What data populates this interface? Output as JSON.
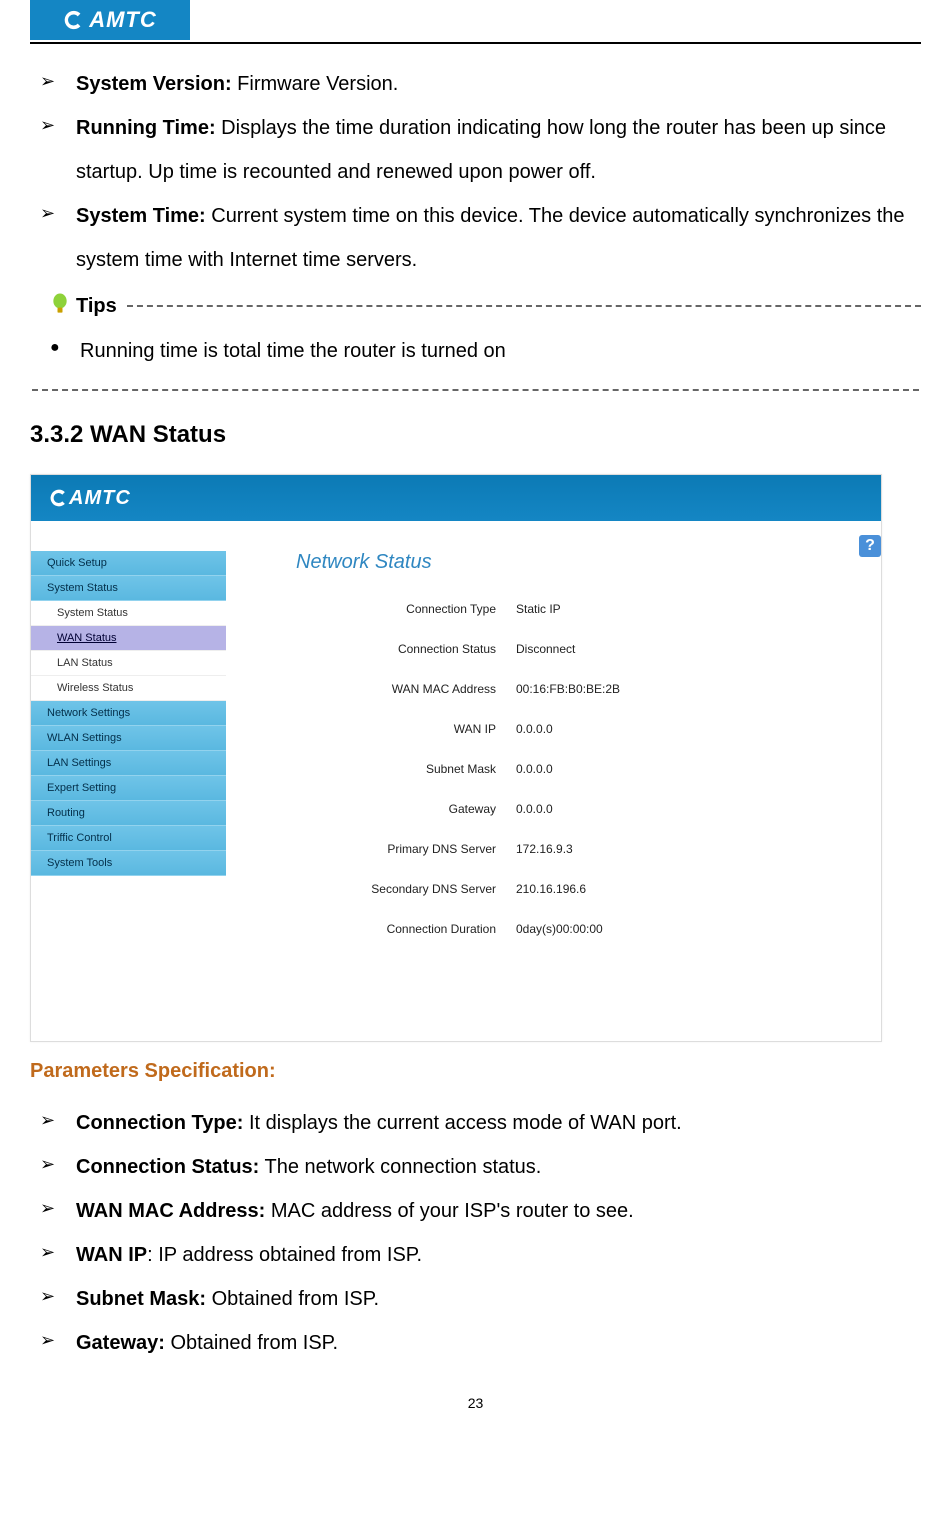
{
  "header": {
    "logo_text": "AMTC"
  },
  "intro_specs": [
    {
      "term": "System Version:",
      "desc": " Firmware Version."
    },
    {
      "term": "Running Time:",
      "desc": " Displays the time duration indicating how long the router has been up since startup. Up time is recounted and renewed upon power off."
    },
    {
      "term": "System Time:",
      "desc": " Current system time on this device. The device automatically synchronizes the system time with Internet time servers."
    }
  ],
  "tips": {
    "label": "Tips",
    "items": [
      "Running time is total time the router is turned on"
    ]
  },
  "section_title": "3.3.2 WAN Status",
  "router_ui": {
    "logo": "AMTC",
    "help": "?",
    "sidebar": [
      {
        "label": "Quick Setup",
        "level": 1,
        "active": false
      },
      {
        "label": "System Status",
        "level": 1,
        "active": false
      },
      {
        "label": "System Status",
        "level": 2,
        "active": false
      },
      {
        "label": "WAN Status",
        "level": 2,
        "active": true
      },
      {
        "label": "LAN Status",
        "level": 2,
        "active": false
      },
      {
        "label": "Wireless Status",
        "level": 2,
        "active": false
      },
      {
        "label": "Network Settings",
        "level": 1,
        "active": false
      },
      {
        "label": "WLAN Settings",
        "level": 1,
        "active": false
      },
      {
        "label": "LAN Settings",
        "level": 1,
        "active": false
      },
      {
        "label": "Expert Setting",
        "level": 1,
        "active": false
      },
      {
        "label": "Routing",
        "level": 1,
        "active": false
      },
      {
        "label": "Triffic Control",
        "level": 1,
        "active": false
      },
      {
        "label": "System Tools",
        "level": 1,
        "active": false
      }
    ],
    "content_title": "Network Status",
    "fields": [
      {
        "label": "Connection Type",
        "value": "Static IP"
      },
      {
        "label": "Connection Status",
        "value": "Disconnect"
      },
      {
        "label": "WAN MAC Address",
        "value": "00:16:FB:B0:BE:2B"
      },
      {
        "label": "WAN IP",
        "value": "0.0.0.0"
      },
      {
        "label": "Subnet Mask",
        "value": "0.0.0.0"
      },
      {
        "label": "Gateway",
        "value": "0.0.0.0"
      },
      {
        "label": "Primary DNS Server",
        "value": "172.16.9.3"
      },
      {
        "label": "Secondary DNS Server",
        "value": "210.16.196.6"
      },
      {
        "label": "Connection Duration",
        "value": "0day(s)00:00:00"
      }
    ]
  },
  "param_head": "Parameters Specification:",
  "param_specs": [
    {
      "term": "Connection Type:",
      "desc": " It displays the current access mode of WAN port."
    },
    {
      "term": "Connection Status:",
      "desc": " The network connection status."
    },
    {
      "term": "WAN MAC Address:",
      "desc": " MAC address of your ISP's router to see."
    },
    {
      "term": "WAN IP",
      "desc": ": IP address obtained from ISP."
    },
    {
      "term": "Subnet Mask:",
      "desc": " Obtained from ISP."
    },
    {
      "term": "Gateway:",
      "desc": " Obtained from ISP."
    }
  ],
  "page_number": "23"
}
